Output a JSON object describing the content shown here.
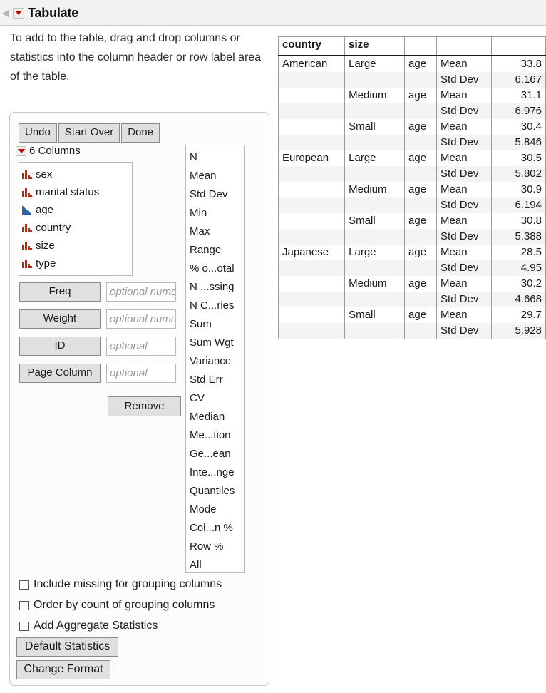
{
  "window": {
    "title": "Tabulate",
    "popup_icon": "red-triangle-menu-icon",
    "disclosure_icon": "disclosure-triangle-icon"
  },
  "instructions": {
    "text": "To add to the table, drag and drop columns or statistics into the column header or row label area of the table."
  },
  "toolbar": {
    "undo_label": "Undo",
    "start_over_label": "Start Over",
    "done_label": "Done"
  },
  "columns_panel": {
    "header_label": "6 Columns",
    "items": [
      {
        "label": "sex",
        "modeling_type": "nominal"
      },
      {
        "label": "marital status",
        "modeling_type": "nominal"
      },
      {
        "label": "age",
        "modeling_type": "continuous"
      },
      {
        "label": "country",
        "modeling_type": "nominal"
      },
      {
        "label": "size",
        "modeling_type": "nominal"
      },
      {
        "label": "type",
        "modeling_type": "nominal"
      }
    ]
  },
  "roles": [
    {
      "button_label": "Freq",
      "field_value": "",
      "field_placeholder": "optional numeric"
    },
    {
      "button_label": "Weight",
      "field_value": "",
      "field_placeholder": "optional numeric"
    },
    {
      "button_label": "ID",
      "field_value": "",
      "field_placeholder": "optional"
    },
    {
      "button_label": "Page Column",
      "field_value": "",
      "field_placeholder": "optional"
    }
  ],
  "remove_button": {
    "label": "Remove"
  },
  "statistics_list": [
    "N",
    "Mean",
    "Std Dev",
    "Min",
    "Max",
    "Range",
    "% o...otal",
    "N ...ssing",
    "N C...ries",
    "Sum",
    "Sum Wgt",
    "Variance",
    "Std Err",
    "CV",
    "Median",
    "Me...tion",
    "Ge...ean",
    "Inte...nge",
    "Quantiles",
    "Mode",
    "Col...n %",
    "Row %",
    "All"
  ],
  "checkboxes": [
    {
      "label": "Include missing for grouping columns",
      "checked": false
    },
    {
      "label": "Order by count of grouping columns",
      "checked": false
    },
    {
      "label": "Add Aggregate Statistics",
      "checked": false
    }
  ],
  "bottom_buttons": [
    {
      "label": "Default Statistics"
    },
    {
      "label": "Change Format"
    }
  ],
  "table": {
    "headers": [
      "country",
      "size",
      "",
      "",
      ""
    ],
    "rows": [
      {
        "country": "American",
        "size": "Large",
        "variable": "age",
        "statistic": "Mean",
        "value": "33.8"
      },
      {
        "country": "",
        "size": "",
        "variable": "",
        "statistic": "Std Dev",
        "value": "6.167"
      },
      {
        "country": "",
        "size": "Medium",
        "variable": "age",
        "statistic": "Mean",
        "value": "31.1"
      },
      {
        "country": "",
        "size": "",
        "variable": "",
        "statistic": "Std Dev",
        "value": "6.976"
      },
      {
        "country": "",
        "size": "Small",
        "variable": "age",
        "statistic": "Mean",
        "value": "30.4"
      },
      {
        "country": "",
        "size": "",
        "variable": "",
        "statistic": "Std Dev",
        "value": "5.846"
      },
      {
        "country": "European",
        "size": "Large",
        "variable": "age",
        "statistic": "Mean",
        "value": "30.5"
      },
      {
        "country": "",
        "size": "",
        "variable": "",
        "statistic": "Std Dev",
        "value": "5.802"
      },
      {
        "country": "",
        "size": "Medium",
        "variable": "age",
        "statistic": "Mean",
        "value": "30.9"
      },
      {
        "country": "",
        "size": "",
        "variable": "",
        "statistic": "Std Dev",
        "value": "6.194"
      },
      {
        "country": "",
        "size": "Small",
        "variable": "age",
        "statistic": "Mean",
        "value": "30.8"
      },
      {
        "country": "",
        "size": "",
        "variable": "",
        "statistic": "Std Dev",
        "value": "5.388"
      },
      {
        "country": "Japanese",
        "size": "Large",
        "variable": "age",
        "statistic": "Mean",
        "value": "28.5"
      },
      {
        "country": "",
        "size": "",
        "variable": "",
        "statistic": "Std Dev",
        "value": "4.95"
      },
      {
        "country": "",
        "size": "Medium",
        "variable": "age",
        "statistic": "Mean",
        "value": "30.2"
      },
      {
        "country": "",
        "size": "",
        "variable": "",
        "statistic": "Std Dev",
        "value": "4.668"
      },
      {
        "country": "",
        "size": "Small",
        "variable": "age",
        "statistic": "Mean",
        "value": "29.7"
      },
      {
        "country": "",
        "size": "",
        "variable": "",
        "statistic": "Std Dev",
        "value": "5.928"
      }
    ]
  }
}
